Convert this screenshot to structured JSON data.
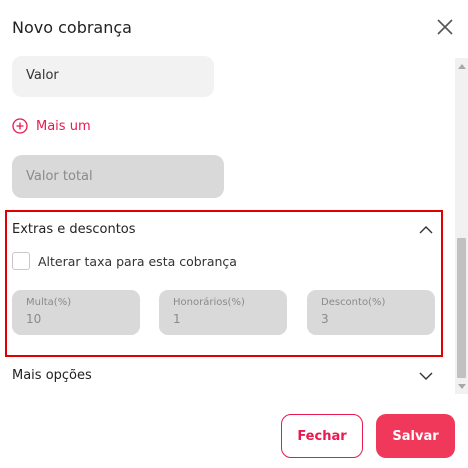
{
  "header": {
    "title": "Novo cobrança"
  },
  "form": {
    "valor_placeholder": "Valor",
    "add_more_label": "Mais um",
    "total_placeholder": "Valor total"
  },
  "extras": {
    "title": "Extras e descontos",
    "checkbox_label": "Alterar taxa para esta cobrança",
    "checkbox_checked": false,
    "fields": [
      {
        "label": "Multa(%)",
        "value": "10"
      },
      {
        "label": "Honorários(%)",
        "value": "1"
      },
      {
        "label": "Desconto(%)",
        "value": "3"
      }
    ]
  },
  "more": {
    "label": "Mais opções"
  },
  "footer": {
    "close_label": "Fechar",
    "save_label": "Salvar"
  },
  "colors": {
    "accent": "#e8194f",
    "save_bg": "#f0385a",
    "highlight_border": "#e00000"
  }
}
